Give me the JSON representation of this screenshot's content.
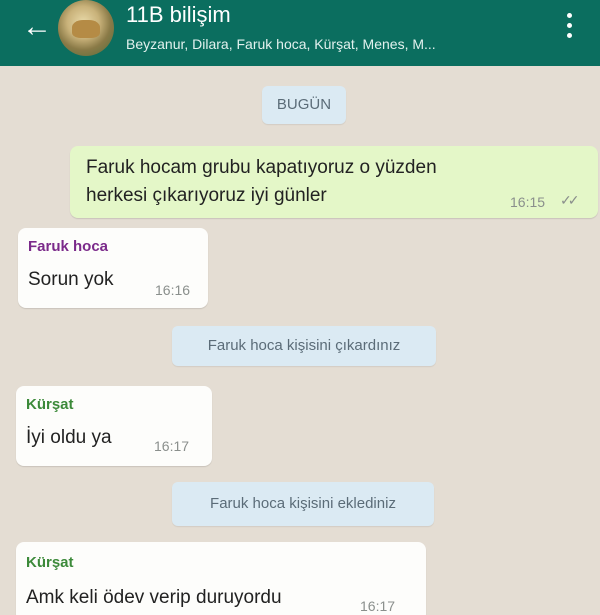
{
  "header": {
    "title": "11B bilişim",
    "members": "Beyzanur, Dilara, Faruk hoca, Kürşat, Menes, M...",
    "back_icon": "arrow-left-icon",
    "menu_icon": "more-vertical-icon",
    "bg_color": "#0b6e5f"
  },
  "chat": {
    "date_label": "BUGÜN",
    "messages": [
      {
        "direction": "outgoing",
        "text_line1": "Faruk hocam grubu kapatıyoruz o yüzden",
        "text_line2": "herkesi çıkarıyoruz iyi günler",
        "time": "16:15",
        "ticks": "✓✓"
      },
      {
        "direction": "incoming",
        "sender": "Faruk hoca",
        "sender_color": "#7b2a8a",
        "text": "Sorun yok",
        "time": "16:16"
      },
      {
        "type": "system",
        "text": "Faruk hoca kişisini çıkardınız"
      },
      {
        "direction": "incoming",
        "sender": "Kürşat",
        "sender_color": "#3c8a3a",
        "text": "İyi oldu ya",
        "time": "16:17"
      },
      {
        "type": "system",
        "text": "Faruk hoca kişisini eklediniz"
      },
      {
        "direction": "incoming",
        "sender": "Kürşat",
        "sender_color": "#3c8a3a",
        "text": "Amk keli ödev verip duruyordu",
        "time": "16:17"
      }
    ]
  },
  "colors": {
    "outgoing_bubble": "#e4f7c8",
    "incoming_bubble": "#fdfdfb",
    "system_bubble": "#dbeaf3",
    "chat_background": "#e4ddd3"
  }
}
